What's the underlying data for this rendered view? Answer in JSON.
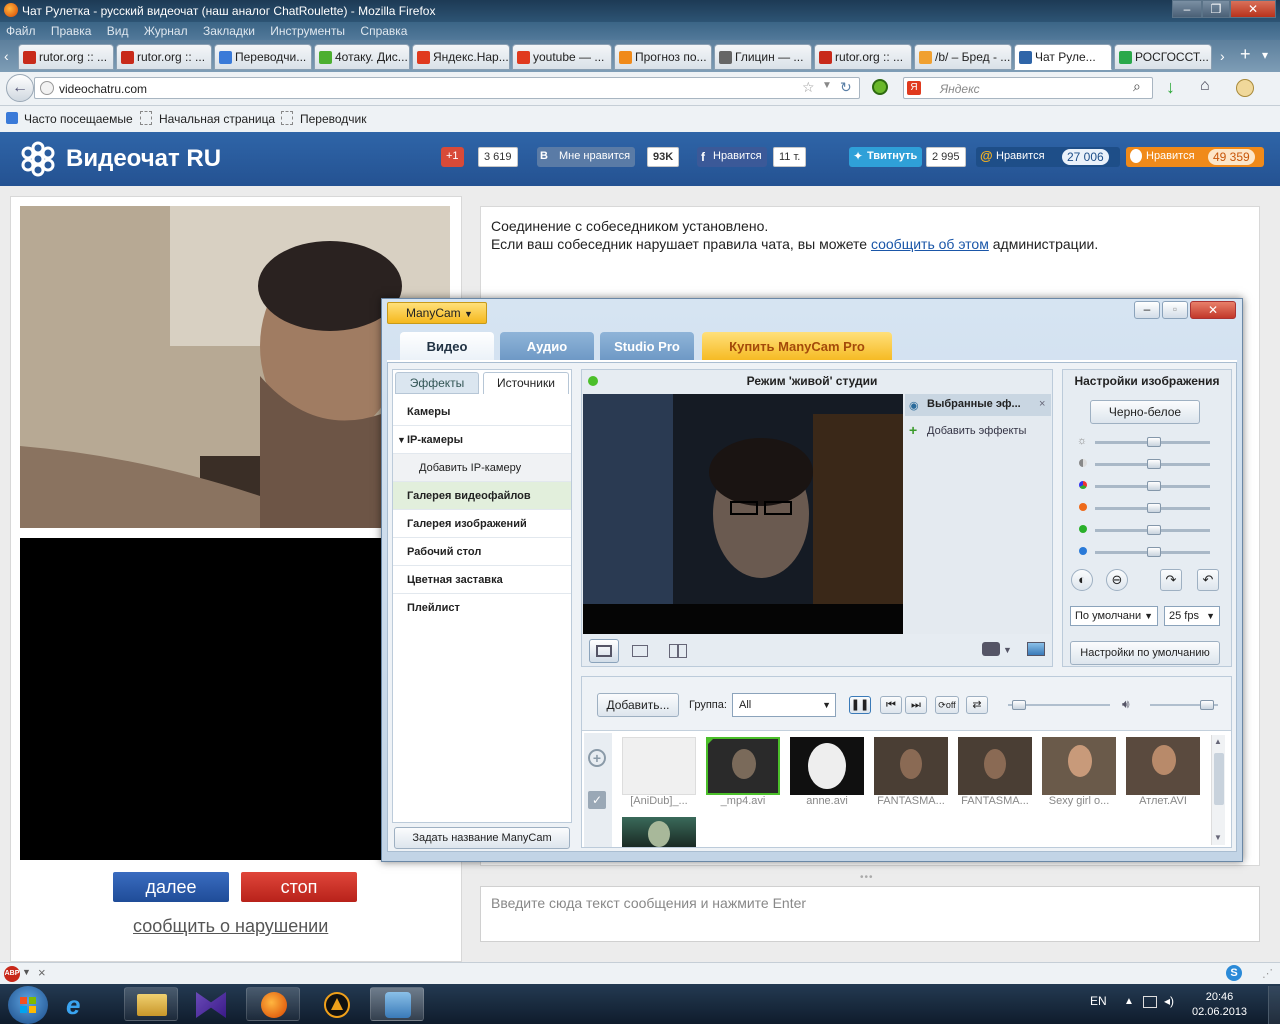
{
  "browser": {
    "window_title": "Чат Рулетка - русский видеочат (наш аналог ChatRoulette) - Mozilla Firefox",
    "menu": [
      "Файл",
      "Правка",
      "Вид",
      "Журнал",
      "Закладки",
      "Инструменты",
      "Справка"
    ],
    "tabs": [
      {
        "label": "rutor.org :: ...",
        "color": "#c82a1a"
      },
      {
        "label": "rutor.org :: ...",
        "color": "#c82a1a"
      },
      {
        "label": "Переводчи...",
        "color": "#3a7ad8"
      },
      {
        "label": "4отаку. Дис...",
        "color": "#4caf30"
      },
      {
        "label": "Яндекс.Нар...",
        "color": "#e03a1e"
      },
      {
        "label": "youtube — ...",
        "color": "#e03a1e"
      },
      {
        "label": "Прогноз по...",
        "color": "#f08a1a"
      },
      {
        "label": "Глицин — ...",
        "color": "#666666"
      },
      {
        "label": "rutor.org :: ...",
        "color": "#c82a1a"
      },
      {
        "label": "/b/ – Бред - ...",
        "color": "#f0a030"
      },
      {
        "label": "Чат Руле...",
        "color": "#2f65a8"
      },
      {
        "label": "РОСГОССТ...",
        "color": "#2aa84a"
      }
    ],
    "url": "videochatru.com",
    "search_placeholder": "Яндекс",
    "bookmarks": [
      "Часто посещаемые",
      "Начальная страница",
      "Переводчик"
    ]
  },
  "site": {
    "logo": "Видеочат RU",
    "social": [
      {
        "label": "+1",
        "count": "3 619",
        "color": "#d84a38"
      },
      {
        "label": "Мне нравится",
        "count": "93K",
        "color": "#5a7ba6"
      },
      {
        "label": "Нравится",
        "count": "11 т.",
        "color": "#3b5998"
      },
      {
        "label": "Твитнуть",
        "count": "2 995",
        "color": "#2fa0d8"
      },
      {
        "label": "Нравится",
        "count": "27 006",
        "color": "#1e4e88"
      },
      {
        "label": "Нравится",
        "count": "49 359",
        "color": "#f08a1a"
      }
    ],
    "next_label": "далее",
    "stop_label": "стоп",
    "report_label": "сообщить о нарушении",
    "chat_line1": "Соединение с собеседником установлено.",
    "chat_line2_pre": "Если ваш собеседник нарушает правила чата, вы можете ",
    "chat_line2_link": "сообщить об этом",
    "chat_line2_post": " администрации.",
    "message_placeholder": "Введите сюда текст сообщения и нажмите Enter"
  },
  "manycam": {
    "badge": "ManyCam",
    "tabs": [
      "Видео",
      "Аудио",
      "Studio Pro",
      "Купить ManyCam Pro"
    ],
    "subtabs": [
      "Эффекты",
      "Источники"
    ],
    "sources": [
      "Камеры",
      "IP-камеры",
      "Добавить IP-камеру",
      "Галерея видеофайлов",
      "Галерея изображений",
      "Рабочий стол",
      "Цветная заставка",
      "Плейлист"
    ],
    "rename_button": "Задать название ManyCam",
    "studio_title": "Режим 'живой' студии",
    "effects_selected": "Выбранные эф...",
    "effects_add": "Добавить эффекты",
    "image_settings_title": "Настройки изображения",
    "bw_button": "Черно-белое",
    "preset_select": "По умолчани",
    "fps_select": "25 fps",
    "defaults_button": "Настройки по умолчанию",
    "add_button": "Добавить...",
    "group_label": "Группа:",
    "group_value": "All",
    "gallery": [
      {
        "label": "[AniDub]_...",
        "color": "#f0f0f0"
      },
      {
        "label": "_mp4.avi",
        "color": "#2a2a2a"
      },
      {
        "label": "anne.avi",
        "color": "#101010"
      },
      {
        "label": "FANTASMA...",
        "color": "#4a3e34"
      },
      {
        "label": "FANTASMA...",
        "color": "#4a3e34"
      },
      {
        "label": "Sexy girl o...",
        "color": "#6a5a4a"
      },
      {
        "label": "Атлет.AVI",
        "color": "#5a4a3e"
      }
    ]
  },
  "taskbar": {
    "lang": "EN",
    "time": "20:46",
    "date": "02.06.2013"
  }
}
